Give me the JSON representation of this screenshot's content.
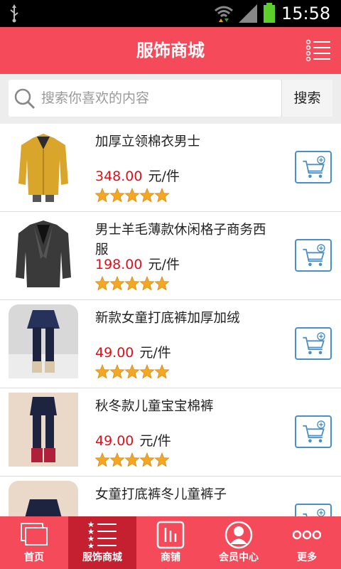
{
  "status_bar": {
    "time": "15:58"
  },
  "header": {
    "title": "服饰商城"
  },
  "search": {
    "placeholder": "搜索你喜欢的内容",
    "button_label": "搜索"
  },
  "products": [
    {
      "name": "加厚立领棉衣男士",
      "price": "348.00",
      "unit": "元/件",
      "rating": 5
    },
    {
      "name": "男士羊毛薄款休闲格子商务西服",
      "price": "198.00",
      "unit": "元/件",
      "rating": 5
    },
    {
      "name": "新款女童打底裤加厚加绒",
      "price": "49.00",
      "unit": "元/件",
      "rating": 5
    },
    {
      "name": "秋冬款儿童宝宝棉裤",
      "price": "49.00",
      "unit": "元/件",
      "rating": 5
    },
    {
      "name": "女童打底裤冬儿童裤子"
    }
  ],
  "bottom_nav": [
    {
      "label": "首页",
      "icon": "home-icon"
    },
    {
      "label": "服饰商城",
      "icon": "list-icon",
      "active": true
    },
    {
      "label": "商铺",
      "icon": "shop-icon"
    },
    {
      "label": "会员中心",
      "icon": "member-icon"
    },
    {
      "label": "更多",
      "icon": "more-icon"
    }
  ],
  "colors": {
    "brand": "#f44a5a",
    "brand_active": "#c42030",
    "price": "#e0101a",
    "cart_border": "#4a8fc5",
    "star": "#f5a623"
  }
}
